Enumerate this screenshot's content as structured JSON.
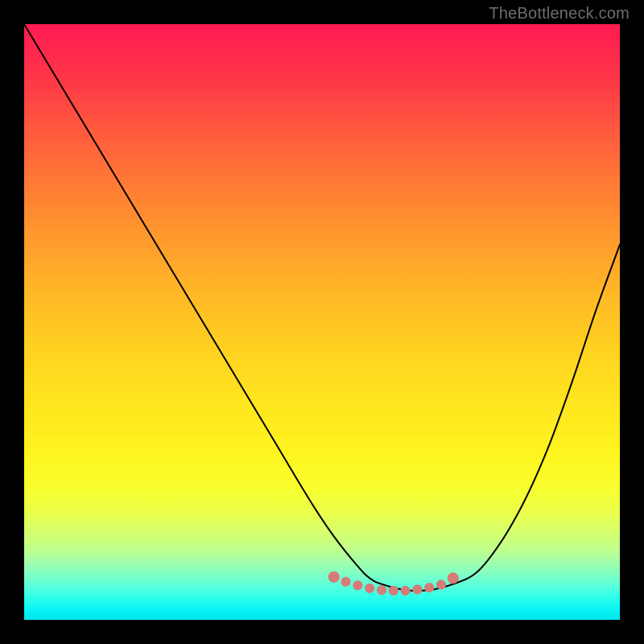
{
  "watermark": "TheBottleneck.com",
  "chart_data": {
    "type": "line",
    "title": "",
    "xlabel": "",
    "ylabel": "",
    "xlim": [
      0,
      100
    ],
    "ylim": [
      0,
      100
    ],
    "grid": false,
    "legend": false,
    "series": [
      {
        "name": "curve",
        "x": [
          0,
          6,
          12,
          18,
          24,
          30,
          36,
          42,
          48,
          52,
          56,
          58,
          60,
          64,
          68,
          72,
          76,
          80,
          84,
          88,
          92,
          96,
          100
        ],
        "values": [
          100,
          90,
          80,
          70,
          60,
          50,
          40,
          30,
          20,
          14,
          9,
          7,
          6,
          5,
          5,
          6,
          8,
          13,
          20,
          29,
          40,
          52,
          63
        ]
      }
    ],
    "annotations": {
      "dots": {
        "x": [
          52,
          54,
          56,
          58,
          60,
          62,
          64,
          66,
          68,
          70,
          72
        ],
        "values": [
          7.2,
          6.4,
          5.8,
          5.3,
          5.0,
          4.9,
          4.9,
          5.1,
          5.4,
          5.9,
          7.0
        ]
      }
    },
    "colors": {
      "curve_stroke": "#000000",
      "dots_fill": "#d67b77",
      "gradient_top": "#ff1a52",
      "gradient_mid": "#ffe41e",
      "gradient_bottom": "#00e6ee",
      "watermark": "#6d6d6d",
      "frame": "#000000"
    }
  }
}
